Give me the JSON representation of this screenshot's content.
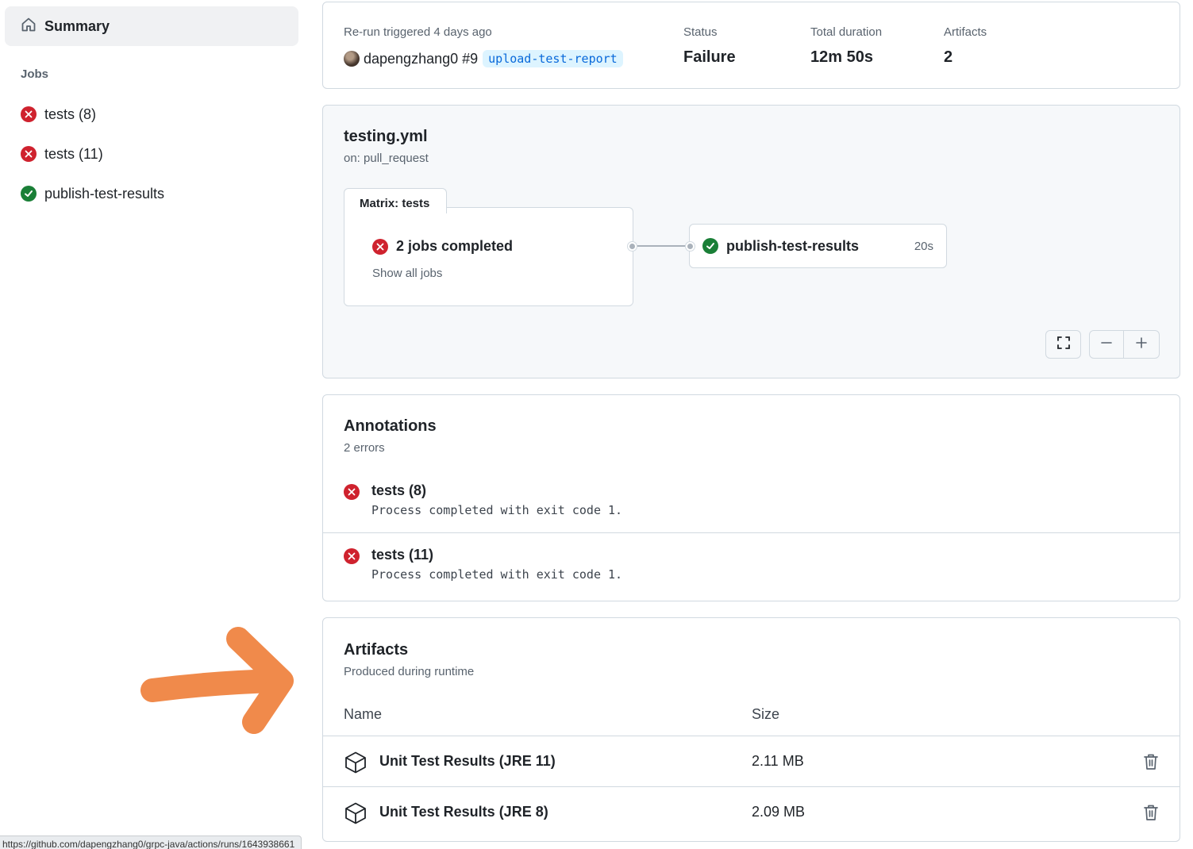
{
  "sidebar": {
    "summary_label": "Summary",
    "jobs_heading": "Jobs",
    "jobs": [
      {
        "label": "tests (8)",
        "status": "failure"
      },
      {
        "label": "tests (11)",
        "status": "failure"
      },
      {
        "label": "publish-test-results",
        "status": "success"
      }
    ]
  },
  "run": {
    "trigger_label": "Re-run triggered 4 days ago",
    "actor": "dapengzhang0",
    "run_number": "#9",
    "branch": "upload-test-report",
    "status_label": "Status",
    "status_value": "Failure",
    "duration_label": "Total duration",
    "duration_value": "12m 50s",
    "artifacts_label": "Artifacts",
    "artifacts_value": "2"
  },
  "workflow": {
    "file": "testing.yml",
    "trigger": "on: pull_request",
    "matrix_tab": "Matrix: tests",
    "matrix_summary": "2 jobs completed",
    "show_all": "Show all jobs",
    "job_name": "publish-test-results",
    "job_duration": "20s"
  },
  "annotations": {
    "title": "Annotations",
    "subtitle": "2 errors",
    "items": [
      {
        "title": "tests (8)",
        "message": "Process completed with exit code 1."
      },
      {
        "title": "tests (11)",
        "message": "Process completed with exit code 1."
      }
    ]
  },
  "artifacts": {
    "title": "Artifacts",
    "subtitle": "Produced during runtime",
    "col_name": "Name",
    "col_size": "Size",
    "items": [
      {
        "name": "Unit Test Results (JRE 11)",
        "size": "2.11 MB"
      },
      {
        "name": "Unit Test Results (JRE 8)",
        "size": "2.09 MB"
      }
    ]
  },
  "statusbar_url": "https://github.com/dapengzhang0/grpc-java/actions/runs/1643938661",
  "colors": {
    "failure": "#cf222e",
    "success": "#1a7f37",
    "arrow": "#f08a4b",
    "branch_bg": "#ddf4ff",
    "branch_fg": "#0969da"
  }
}
